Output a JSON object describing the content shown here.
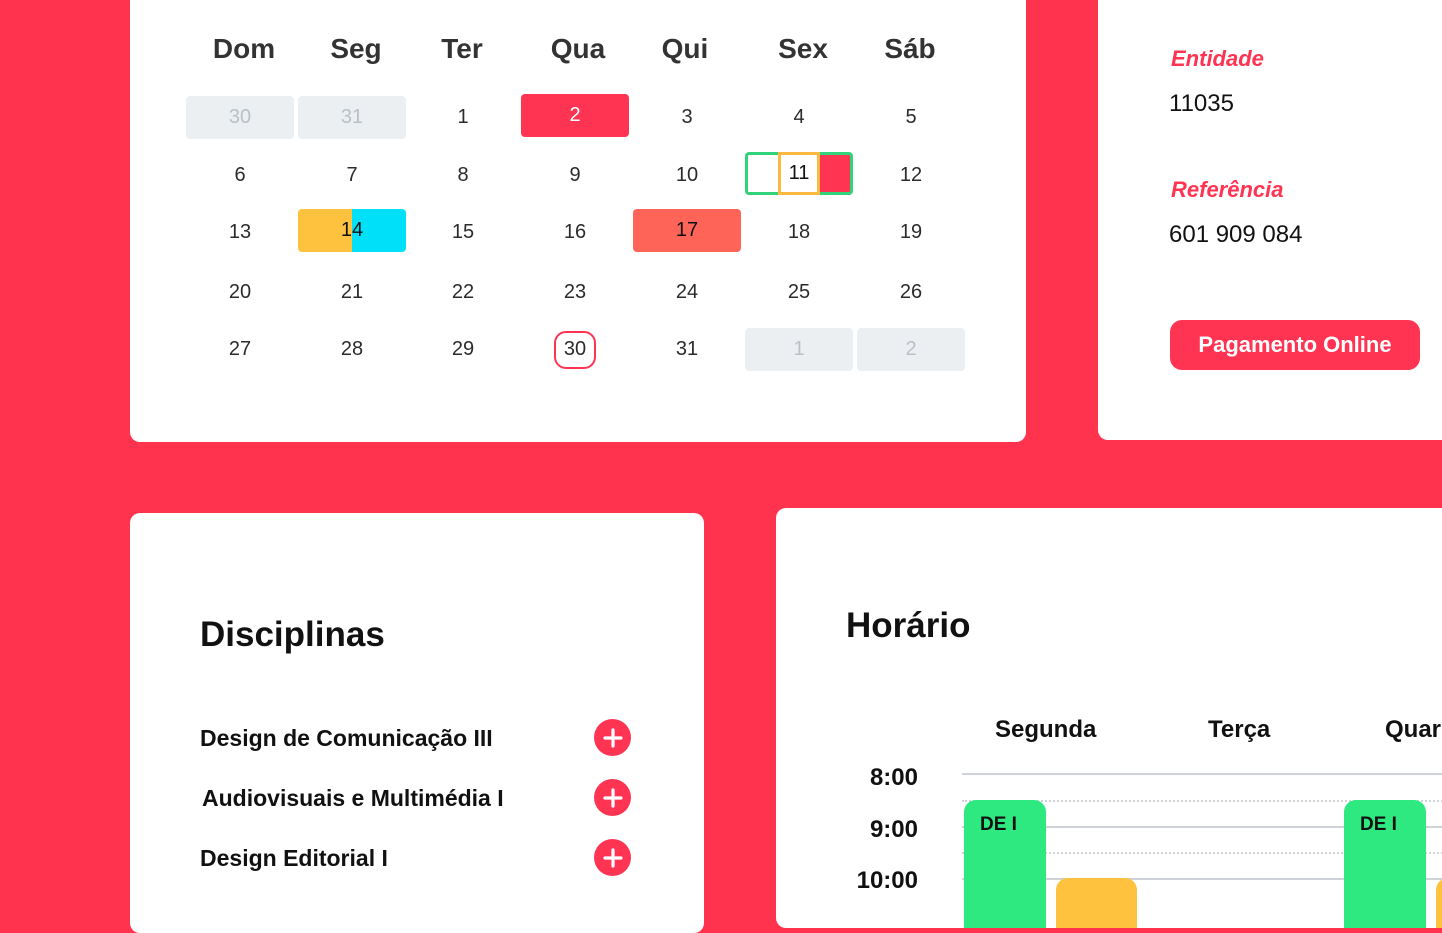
{
  "calendar": {
    "weekdays": [
      "Dom",
      "Seg",
      "Ter",
      "Qua",
      "Qui",
      "Sex",
      "Sáb"
    ],
    "weeks": [
      [
        "30",
        "31",
        "1",
        "2",
        "3",
        "4",
        "5"
      ],
      [
        "6",
        "7",
        "8",
        "9",
        "10",
        "11",
        "12"
      ],
      [
        "13",
        "14",
        "15",
        "16",
        "17",
        "18",
        "19"
      ],
      [
        "20",
        "21",
        "22",
        "23",
        "24",
        "25",
        "26"
      ],
      [
        "27",
        "28",
        "29",
        "30",
        "31",
        "1",
        "2"
      ]
    ],
    "colors": {
      "red": "#ff3452",
      "coral": "#ff6458",
      "yellow": "#ffc23f",
      "cyan": "#00e0f8",
      "green": "#31d27a",
      "muted": "#eceff2"
    }
  },
  "payment": {
    "entity_label": "Entidade",
    "entity_value": "11035",
    "reference_label": "Referência",
    "reference_value": "601 909 084",
    "button_label": "Pagamento Online"
  },
  "disciplines": {
    "title": "Disciplinas",
    "items": [
      {
        "name": "Design de Comunicação III",
        "icon": "plus-icon"
      },
      {
        "name": "Audiovisuais e Multimédia I",
        "icon": "plus-icon"
      },
      {
        "name": "Design Editorial I",
        "icon": "plus-icon"
      }
    ]
  },
  "schedule": {
    "title": "Horário",
    "days": [
      "Segunda",
      "Terça",
      "Quar"
    ],
    "times": [
      "8:00",
      "9:00",
      "10:00"
    ],
    "events": [
      {
        "label": "DE I",
        "color": "#2ee880"
      },
      {
        "label": "DE I",
        "color": "#2ee880"
      },
      {
        "label": "",
        "color": "#ffc23f"
      },
      {
        "label": "",
        "color": "#ffc23f"
      }
    ]
  },
  "theme": {
    "accent": "#ff334e"
  }
}
